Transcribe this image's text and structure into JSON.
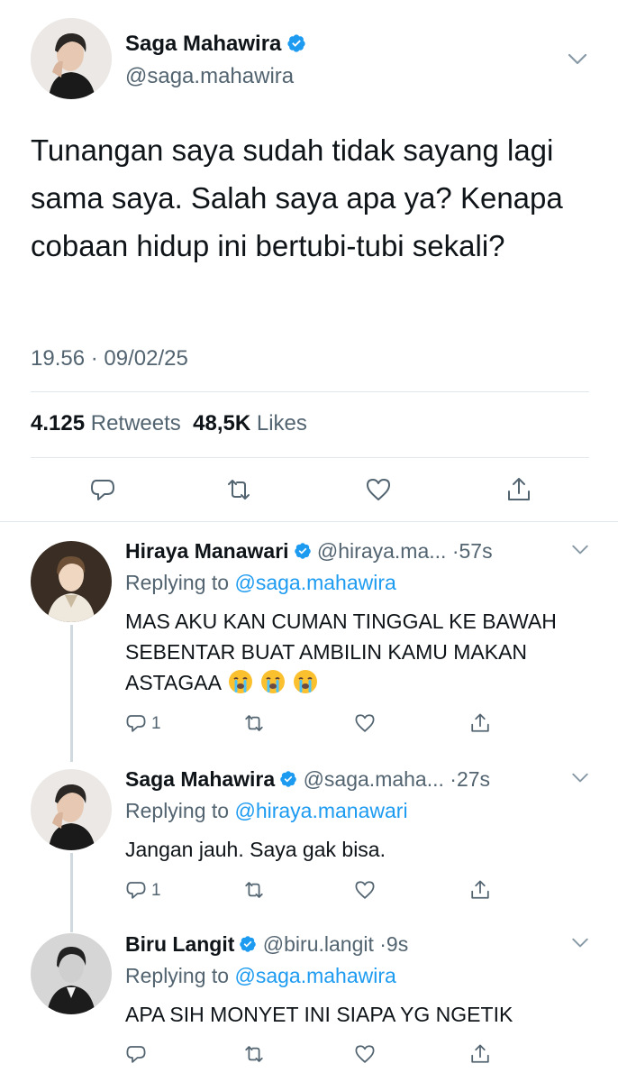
{
  "main_tweet": {
    "name": "Saga Mahawira",
    "handle": "@saga.mahawira",
    "text": "Tunangan saya sudah tidak sayang lagi sama saya. Salah saya apa ya? Kenapa cobaan hidup ini bertubi-tubi sekali?",
    "timestamp": "19.56 · 09/02/25",
    "retweet_count": "4.125",
    "retweet_label": "Retweets",
    "like_count": "48,5K",
    "like_label": "Likes"
  },
  "replies": [
    {
      "name": "Hiraya Manawari",
      "handle": "@hiraya.ma...",
      "time": "·57s",
      "replying_prefix": "Replying to",
      "replying_to": "@saga.mahawira",
      "text": "MAS AKU KAN CUMAN TINGGAL KE BAWAH SEBENTAR BUAT AMBILIN KAMU MAKAN ASTAGAA",
      "reply_count": "1",
      "emojis": [
        "loudly-crying-face",
        "loudly-crying-face",
        "loudly-crying-face"
      ]
    },
    {
      "name": "Saga Mahawira",
      "handle": "@saga.maha...",
      "time": "·27s",
      "replying_prefix": "Replying to",
      "replying_to": "@hiraya.manawari",
      "text": "Jangan jauh. Saya gak bisa.",
      "reply_count": "1"
    },
    {
      "name": "Biru Langit",
      "handle": "@biru.langit",
      "time": "·9s",
      "replying_prefix": "Replying to",
      "replying_to": "@saga.mahawira",
      "text": "APA SIH MONYET INI SIAPA YG NGETIK",
      "reply_count": ""
    }
  ],
  "colors": {
    "accent": "#1d9bf0",
    "muted": "#536471",
    "text": "#0f1419",
    "divider": "#e1e8ed"
  }
}
